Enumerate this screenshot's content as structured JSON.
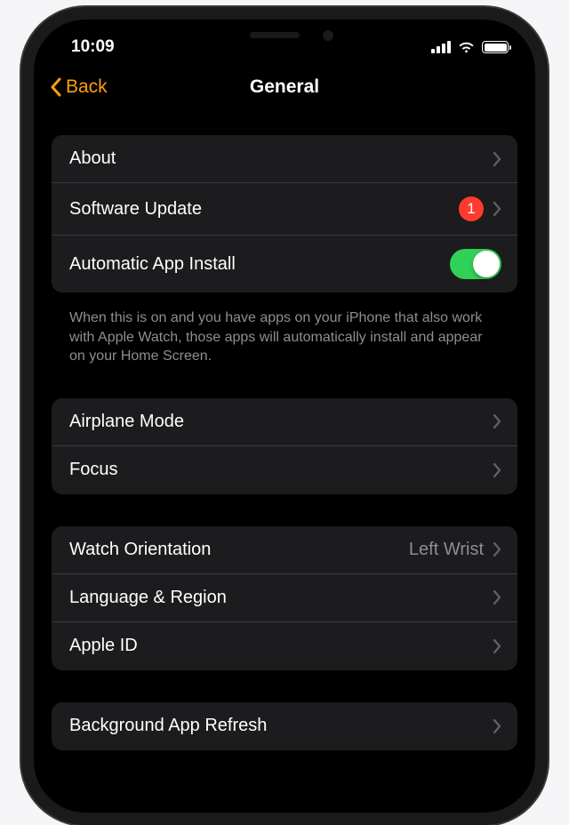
{
  "status": {
    "time": "10:09"
  },
  "nav": {
    "back_label": "Back",
    "title": "General"
  },
  "group1": {
    "about": "About",
    "software_update": "Software Update",
    "software_update_badge": "1",
    "auto_install": "Automatic App Install",
    "auto_install_on": true,
    "footer": "When this is on and you have apps on your iPhone that also work with Apple Watch, those apps will automatically install and appear on your Home Screen."
  },
  "group2": {
    "airplane": "Airplane Mode",
    "focus": "Focus"
  },
  "group3": {
    "orientation_label": "Watch Orientation",
    "orientation_value": "Left Wrist",
    "language": "Language & Region",
    "apple_id": "Apple ID"
  },
  "group4": {
    "background_refresh": "Background App Refresh"
  }
}
